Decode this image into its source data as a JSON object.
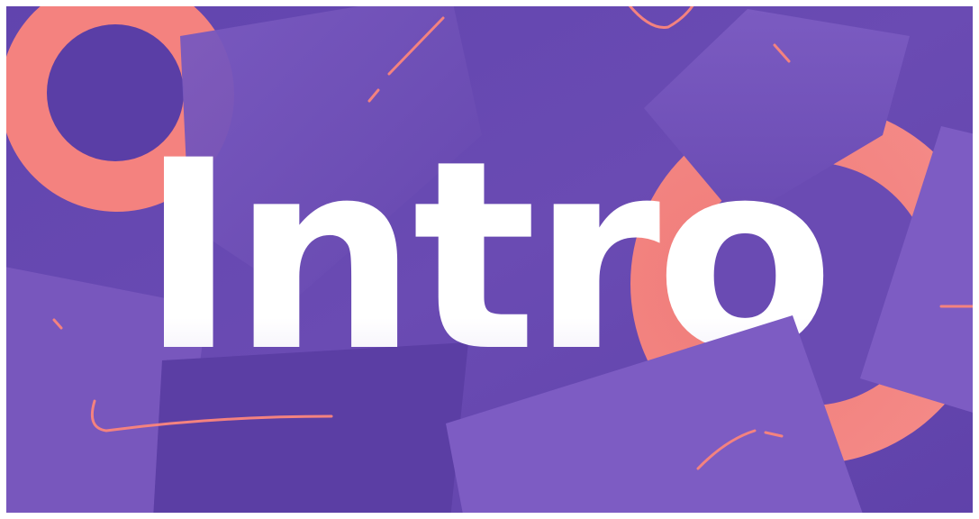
{
  "title": "Intro",
  "colors": {
    "background": "#6a4bb3",
    "background_dark": "#5a3ea6",
    "panel": "#7857bd",
    "panel_light": "#7d5cc3",
    "panel_dark": "#5b3ea4",
    "accent": "#f4827f",
    "accent_soft": "#f48a87",
    "text": "#ffffff",
    "frame": "#ffffff"
  }
}
